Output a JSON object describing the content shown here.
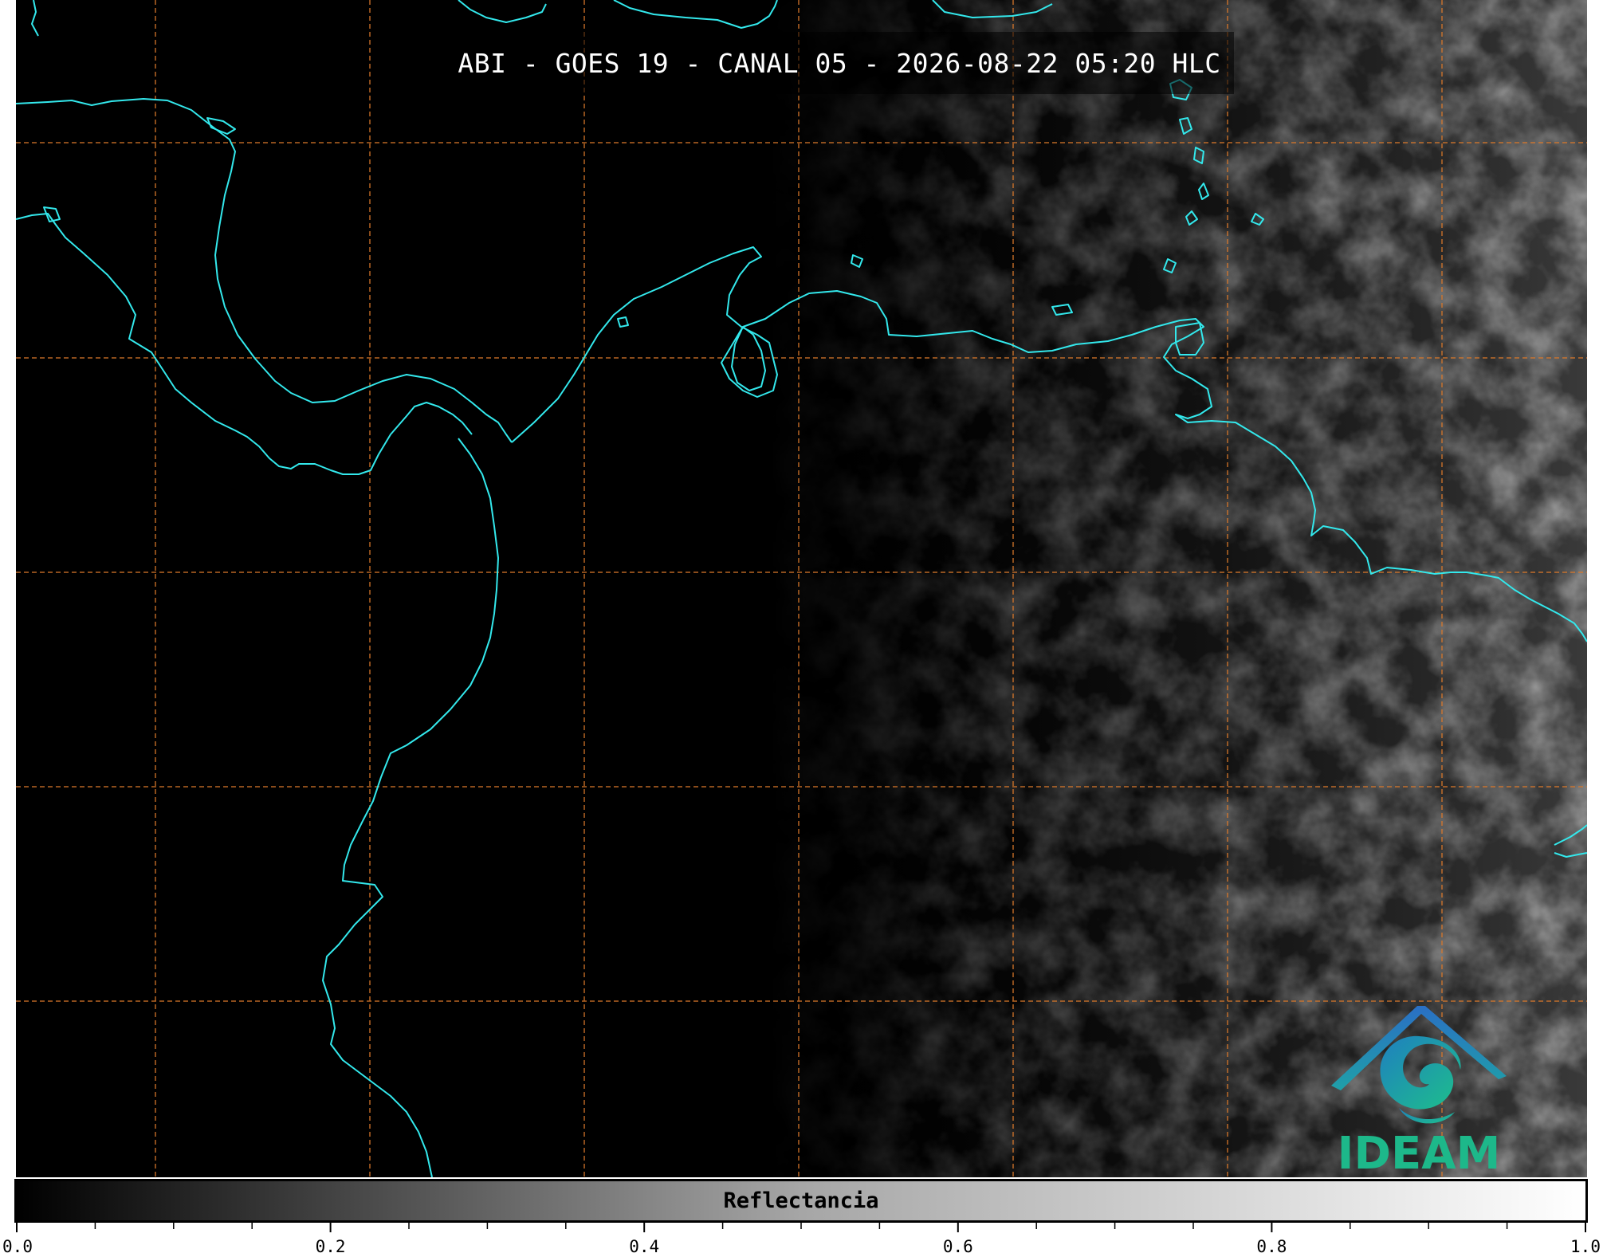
{
  "title": "ABI - GOES 19 - CANAL 05 - 2026-08-22 05:20 HLC",
  "logo": {
    "text": "IDEAM",
    "icon": "ideam-logo-icon"
  },
  "colorbar": {
    "label": "Reflectancia",
    "min": 0.0,
    "max": 1.0,
    "ticks": [
      "0.0",
      "0.2",
      "0.4",
      "0.6",
      "0.8",
      "1.0"
    ]
  },
  "colors": {
    "coastline": "#33e8ec",
    "gridlines": "#d9782a",
    "background": "#000000",
    "logo_text": "#1db88a",
    "logo_roof": "#2a6fc4"
  }
}
